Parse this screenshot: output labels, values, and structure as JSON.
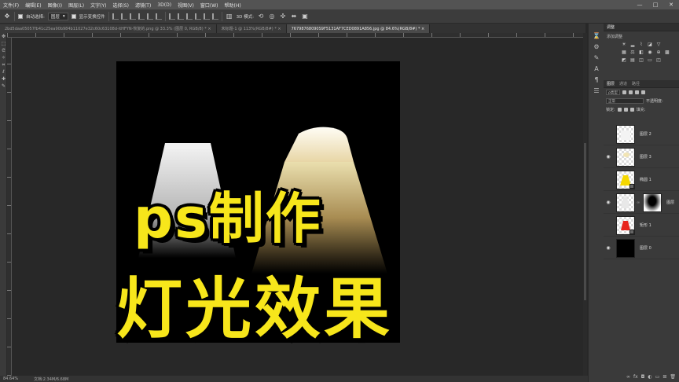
{
  "menubar": {
    "items": [
      "文件(F)",
      "编辑(E)",
      "图像(I)",
      "图层(L)",
      "文字(Y)",
      "选择(S)",
      "滤镜(T)",
      "3D(D)",
      "视图(V)",
      "窗口(W)",
      "帮助(H)"
    ],
    "controls": [
      "—",
      "□",
      "✕"
    ]
  },
  "options": {
    "auto_select_label": "自动选择:",
    "auto_select_value": "图层",
    "show_transform_label": "显示变换控件",
    "mode_3d_label": "3D 模式:"
  },
  "tabs": [
    {
      "label": "2bd5daa05057fb41c25ea90b984b11027e32c60c63108d-itHFYN-恢复的.png @ 33.3% (图层 0, RGB/8) *",
      "active": false
    },
    {
      "label": "未标题-1 @ 113%(RGB/8#) *",
      "active": false
    },
    {
      "label": "76798768090S9F5131AF7CED0891A856.jpg @ 84.6%(RGB/8#) *",
      "active": true
    }
  ],
  "canvas": {
    "line1": "ps制作",
    "line2": "灯光效果",
    "text_color": "#f7e61b"
  },
  "status": {
    "zoom": "84.64%",
    "doc": "文档:2.34M/6.68M"
  },
  "panels": {
    "adjust_tab": "调整",
    "adjust_sub": "添加调整",
    "layer_tabs": [
      "图层",
      "通道",
      "路径"
    ],
    "kind_filter": "ρ类型",
    "blend_mode": "正常",
    "opacity": "不透明度:",
    "lock_label": "锁定:",
    "fill": "填充:",
    "layers": [
      {
        "name": "图层 2",
        "visible": false,
        "thumb": "light-white"
      },
      {
        "name": "图层 3",
        "visible": true,
        "thumb": "light-warm"
      },
      {
        "name": "椭圆 1",
        "visible": false,
        "thumb": "yellow-shape"
      },
      {
        "name": "图层",
        "visible": true,
        "thumb": "white-cone",
        "has_mask": true
      },
      {
        "name": "矩形 1",
        "visible": false,
        "thumb": "red-shape"
      },
      {
        "name": "图层 0",
        "visible": true,
        "thumb": "black"
      }
    ]
  },
  "icons": {
    "strip": [
      "history-icon",
      "adjust-icon",
      "brush-icon",
      "character-icon",
      "paragraph-icon",
      "properties-icon"
    ],
    "layer_actions": [
      "link-icon",
      "fx-icon",
      "mask-icon",
      "adjustment-icon",
      "group-icon",
      "new-layer-icon",
      "trash-icon"
    ]
  }
}
